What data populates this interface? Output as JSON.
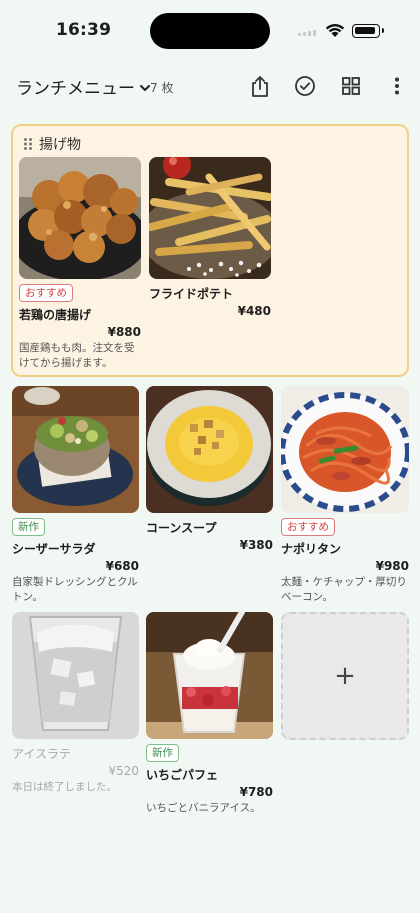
{
  "status": {
    "time": "16:39"
  },
  "header": {
    "title": "ランチメニュー",
    "count": "7 枚",
    "icons": [
      "share-icon",
      "check-circle-icon",
      "grid-view-icon",
      "more-vert-icon"
    ]
  },
  "group": {
    "title": "揚げ物",
    "items": [
      {
        "name": "若鶏の唐揚げ",
        "price": "¥880",
        "badge": "おすすめ",
        "desc": "国産鶏もも肉。注文を受けてから揚げます。"
      },
      {
        "name": "フライドポテト",
        "price": "¥480",
        "badge": "",
        "desc": ""
      }
    ]
  },
  "items": [
    {
      "name": "シーザーサラダ",
      "price": "¥680",
      "badge": "新作",
      "desc": "自家製ドレッシングとクルトン。"
    },
    {
      "name": "コーンスープ",
      "price": "¥380",
      "badge": "",
      "desc": ""
    },
    {
      "name": "ナポリタン",
      "price": "¥980",
      "badge": "おすすめ",
      "desc": "太麺・ケチャップ・厚切りベーコン。"
    },
    {
      "name": "アイスラテ",
      "price": "¥520",
      "badge": "",
      "desc": "本日は終了しました。"
    },
    {
      "name": "いちごパフェ",
      "price": "¥780",
      "badge": "新作",
      "desc": "いちごとバニラアイス。"
    }
  ],
  "add_tile": {
    "label": "+"
  },
  "colors": {
    "background": "#f1f8f3",
    "group_bg": "#fdf3e3",
    "group_border": "#f1ce85",
    "recommend": "#d14545",
    "new": "#3d8b4c"
  }
}
